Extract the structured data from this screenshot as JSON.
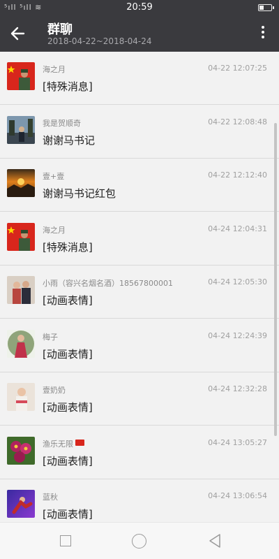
{
  "status_bar": {
    "signal": "⁵ıll ⁵ıll ≋",
    "time": "20:59",
    "battery_level": 0.4
  },
  "header": {
    "title": "群聊",
    "date_range": "2018-04-22~2018-04-24"
  },
  "messages": [
    {
      "name": "海之月",
      "time": "04-22 12:07:25",
      "text": "[特殊消息]",
      "avatar": "flag-soldier"
    },
    {
      "name": "我是贺顺奇",
      "time": "04-22 12:08:48",
      "text": "谢谢马书记",
      "avatar": "photo-blue"
    },
    {
      "name": "壹+壹",
      "time": "04-22 12:12:40",
      "text": "谢谢马书记红包",
      "avatar": "sunset"
    },
    {
      "name": "海之月",
      "time": "04-24 12:04:31",
      "text": "[特殊消息]",
      "avatar": "flag-soldier"
    },
    {
      "name": "小雨（容兴名烟名酒）18567800001",
      "time": "04-24 12:05:30",
      "text": "[动画表情]",
      "avatar": "couple"
    },
    {
      "name": "梅子",
      "time": "04-24 12:24:39",
      "text": "[动画表情]",
      "avatar": "girl-red"
    },
    {
      "name": "壹奶奶",
      "time": "04-24 12:32:28",
      "text": "[动画表情]",
      "avatar": "child"
    },
    {
      "name": "渔乐无限",
      "time": "04-24 13:05:27",
      "text": "[动画表情]",
      "avatar": "flowers",
      "flag": true
    },
    {
      "name": "蓝秋",
      "time": "04-24 13:06:54",
      "text": "[动画表情]",
      "avatar": "skater"
    }
  ]
}
